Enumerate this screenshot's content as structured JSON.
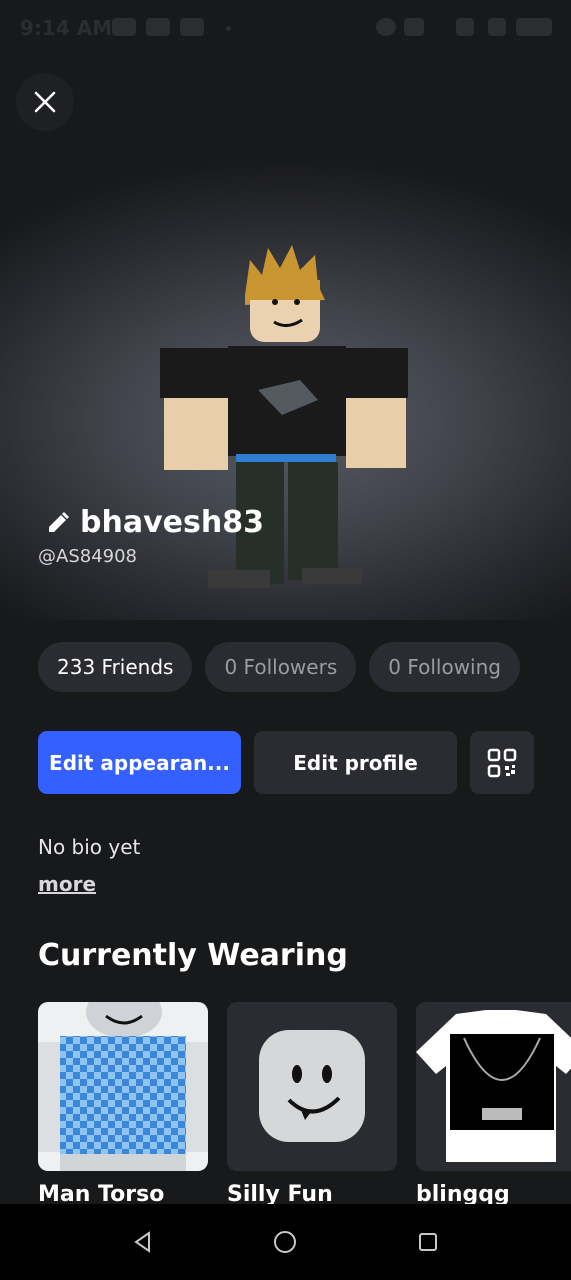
{
  "status_bar": {
    "time": "9:14 AM"
  },
  "profile": {
    "display_name": "bhavesh83",
    "username": "@AS84908"
  },
  "stats": {
    "friends": "233 Friends",
    "followers": "0 Followers",
    "following": "0 Following"
  },
  "actions": {
    "edit_appearance": "Edit appearan...",
    "edit_profile": "Edit profile"
  },
  "bio": {
    "text": "No bio yet",
    "more": "more"
  },
  "wearing": {
    "title": "Currently Wearing",
    "items": [
      {
        "label": "Man Torso"
      },
      {
        "label": "Silly Fun"
      },
      {
        "label": "blingqg"
      }
    ]
  },
  "colors": {
    "primary_button": "#3360ff",
    "background": "#18191b",
    "pill": "#2b2c31"
  }
}
